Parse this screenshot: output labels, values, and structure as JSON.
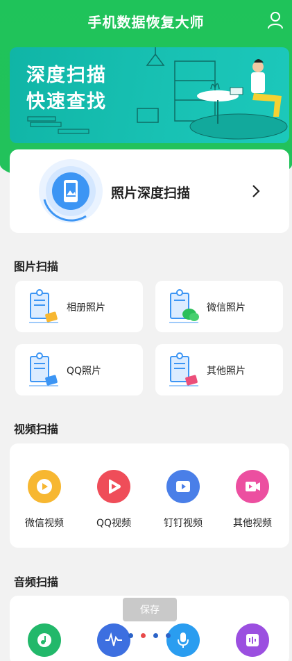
{
  "header": {
    "title": "手机数据恢复大师",
    "user_icon": "user-icon"
  },
  "banner": {
    "line1": "深度扫描",
    "line2": "快速查找"
  },
  "deep_scan": {
    "label": "照片深度扫描",
    "icon": "phone-scan-icon",
    "arrow_icon": "chevron-right-icon"
  },
  "photo_section": {
    "title": "图片扫描",
    "items": [
      {
        "label": "相册照片",
        "icon": "album-photo-icon"
      },
      {
        "label": "微信照片",
        "icon": "wechat-photo-icon"
      },
      {
        "label": "QQ照片",
        "icon": "qq-photo-icon"
      },
      {
        "label": "其他照片",
        "icon": "other-photo-icon"
      }
    ]
  },
  "video_section": {
    "title": "视频扫描",
    "items": [
      {
        "label": "微信视频",
        "color": "#f7b731"
      },
      {
        "label": "QQ视频",
        "color": "#ef4d59"
      },
      {
        "label": "钉钉视频",
        "color": "#4a7fe8"
      },
      {
        "label": "其他视频",
        "color": "#ec4fa0"
      }
    ]
  },
  "audio_section": {
    "title": "音频扫描",
    "items": [
      {
        "icon": "music-icon",
        "color": "#22b86a"
      },
      {
        "icon": "waveform-icon",
        "color": "#3d6fe0"
      },
      {
        "icon": "microphone-icon",
        "color": "#2a9df0"
      },
      {
        "icon": "audio-file-icon",
        "color": "#9b4fe0"
      }
    ]
  },
  "toast": {
    "label": "保存"
  },
  "pager": {
    "count": 4,
    "active_index": 1
  },
  "colors": {
    "brand_green": "#22c35b",
    "banner_teal": "#18c1b3"
  }
}
